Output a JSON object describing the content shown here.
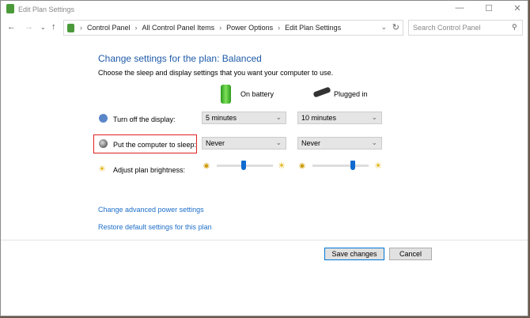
{
  "window": {
    "title": "Edit Plan Settings"
  },
  "address": {
    "crumbs": [
      "Control Panel",
      "All Control Panel Items",
      "Power Options",
      "Edit Plan Settings"
    ]
  },
  "search": {
    "placeholder": "Search Control Panel"
  },
  "main": {
    "heading": "Change settings for the plan: Balanced",
    "subtitle": "Choose the sleep and display settings that you want your computer to use.",
    "col_battery": "On battery",
    "col_plugged": "Plugged in",
    "display_label": "Turn off the display:",
    "display_battery": "5 minutes",
    "display_plugged": "10 minutes",
    "sleep_label": "Put the computer to sleep:",
    "sleep_battery": "Never",
    "sleep_plugged": "Never",
    "brightness_label": "Adjust plan brightness:",
    "brightness_battery_pct": 48,
    "brightness_plugged_pct": 72,
    "link_advanced": "Change advanced power settings",
    "link_restore": "Restore default settings for this plan"
  },
  "buttons": {
    "save": "Save changes",
    "cancel": "Cancel"
  },
  "colors": {
    "accent": "#1e5aa8",
    "highlight": "#e02020",
    "slider": "#0f6ad0"
  }
}
